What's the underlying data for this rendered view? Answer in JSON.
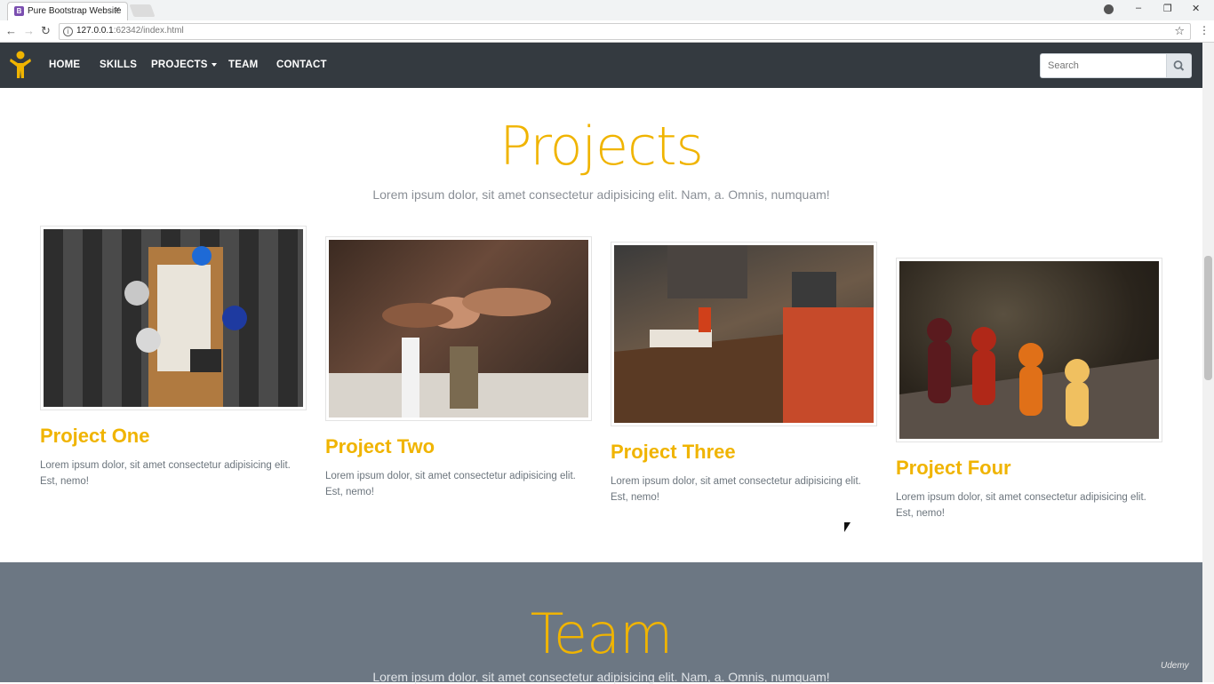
{
  "browser": {
    "tab_title": "Pure Bootstrap Website",
    "tab_favicon": "B",
    "close_glyph": "×",
    "url_host": "127.0.0.1",
    "url_rest": ":62342/index.html",
    "back_glyph": "←",
    "forward_glyph": "→",
    "reload_glyph": "↻",
    "star_glyph": "☆",
    "menu_glyph": "⋮",
    "minimize_glyph": "–",
    "restore_glyph": "❐",
    "window_close_glyph": "✕"
  },
  "navbar": {
    "items": [
      "HOME",
      "SKILLS",
      "PROJECTS",
      "TEAM",
      "CONTACT"
    ],
    "search_placeholder": "Search"
  },
  "projects": {
    "title": "Projects",
    "subtitle": "Lorem ipsum dolor, sit amet consectetur adipisicing elit. Nam, a. Omnis, numquam!",
    "cards": [
      {
        "title": "Project One",
        "text": "Lorem ipsum dolor, sit amet consectetur adipisicing elit. Est, nemo!"
      },
      {
        "title": "Project Two",
        "text": "Lorem ipsum dolor, sit amet consectetur adipisicing elit. Est, nemo!"
      },
      {
        "title": "Project Three",
        "text": "Lorem ipsum dolor, sit amet consectetur adipisicing elit. Est, nemo!"
      },
      {
        "title": "Project Four",
        "text": "Lorem ipsum dolor, sit amet consectetur adipisicing elit. Est, nemo!"
      }
    ]
  },
  "team": {
    "title": "Team",
    "subtitle": "Lorem ipsum dolor, sit amet consectetur adipisicing elit. Nam, a. Omnis, numquam!"
  },
  "watermark": "Udemy",
  "colors": {
    "accent": "#f0b400",
    "navbar": "#343a40",
    "team_bg": "#6c7783"
  }
}
